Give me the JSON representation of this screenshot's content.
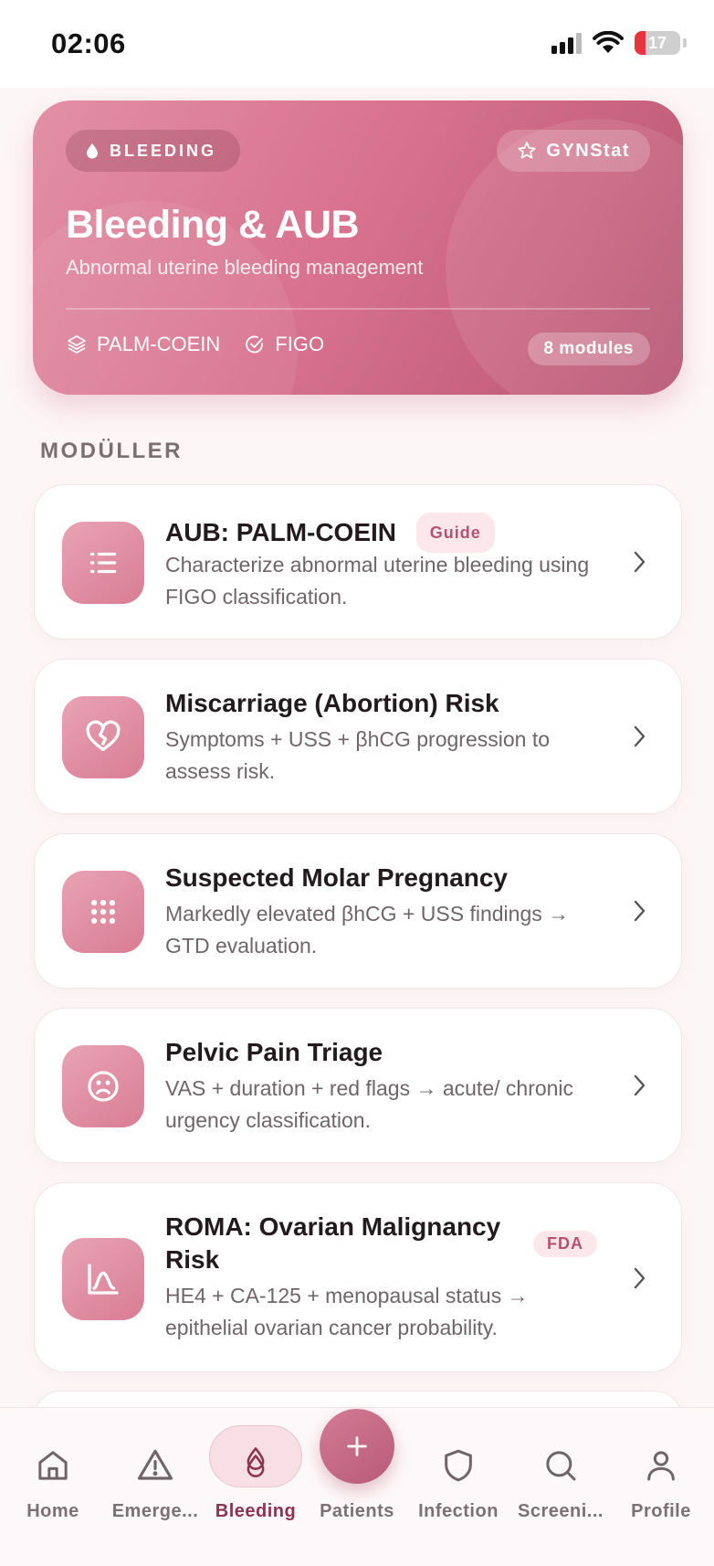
{
  "status_bar": {
    "time": "02:06",
    "battery": "17"
  },
  "hero": {
    "badge": "BLEEDING",
    "brand": "GYNStat",
    "title": "Bleeding & AUB",
    "subtitle": "Abnormal uterine bleeding management",
    "tags": [
      "PALM-COEIN",
      "FIGO"
    ],
    "modules_count": "8 modules"
  },
  "section_label": "MODÜLLER",
  "modules": [
    {
      "title": "AUB: PALM-COEIN",
      "badge": "Guide",
      "desc": "Characterize abnormal uterine bleeding using FIGO classification.",
      "icon": "list-icon"
    },
    {
      "title": "Miscarriage (Abortion) Risk",
      "desc": "Symptoms + USS + βhCG progression to assess risk.",
      "icon": "broken-heart-icon"
    },
    {
      "title": "Suspected Molar Pregnancy",
      "desc": "Markedly elevated βhCG + USS findings → GTD evaluation.",
      "icon": "grid-dots-icon"
    },
    {
      "title": "Pelvic Pain Triage",
      "desc": "VAS + duration + red flags → acute/ chronic urgency classification.",
      "icon": "sad-face-icon"
    },
    {
      "title": "ROMA: Ovarian Malignancy Risk",
      "badge": "FDA",
      "desc": "HE4 + CA-125 + menopausal status → epithelial ovarian cancer probability.",
      "icon": "bell-curve-icon"
    }
  ],
  "tabs": [
    {
      "label": "Home",
      "icon": "home-icon"
    },
    {
      "label": "Emerge...",
      "icon": "warning-icon"
    },
    {
      "label": "Bleeding",
      "icon": "drop-icon",
      "active": true
    },
    {
      "label": "Patients",
      "icon": "plus-icon"
    },
    {
      "label": "Infection",
      "icon": "shield-icon"
    },
    {
      "label": "Screeni...",
      "icon": "search-icon"
    },
    {
      "label": "Profile",
      "icon": "person-icon"
    }
  ],
  "colors": {
    "accent": "#d9738f",
    "active_tab": "#8c3350",
    "badge_bg": "#fbe7ec"
  }
}
